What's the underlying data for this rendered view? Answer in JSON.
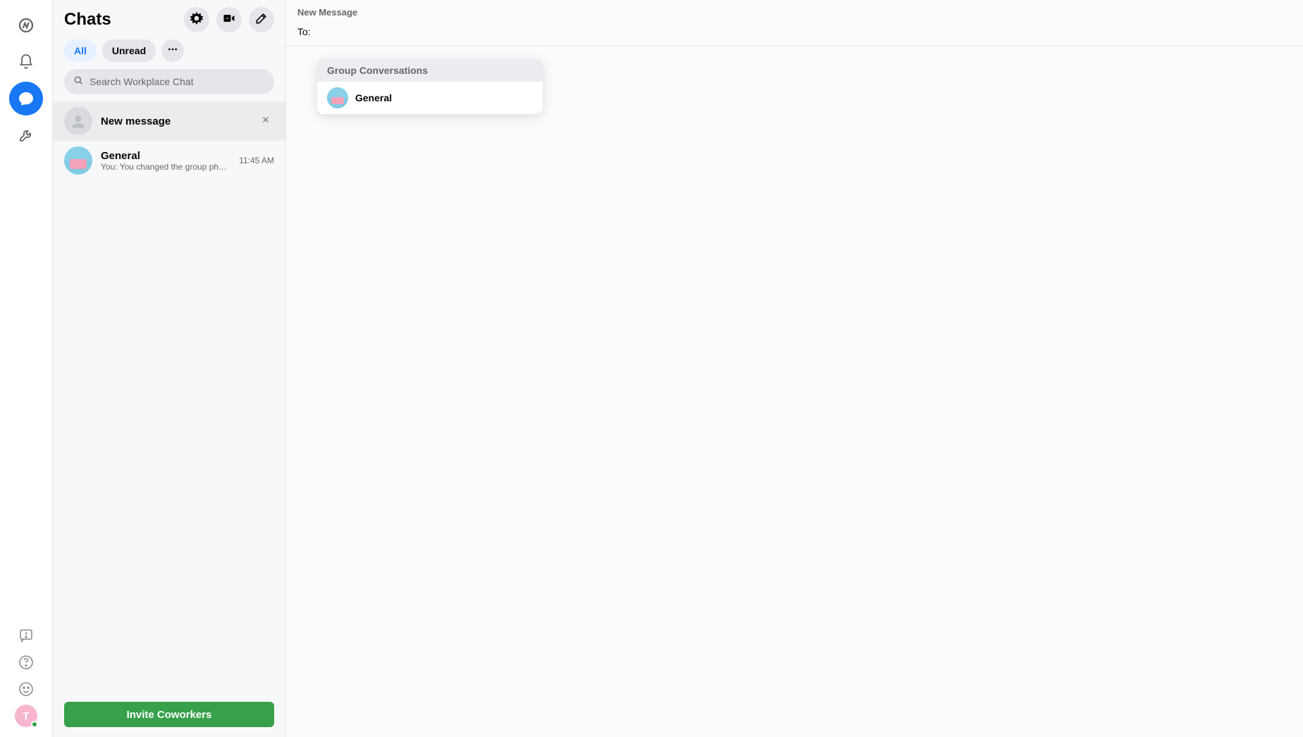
{
  "rail": {
    "avatar_initial": "T"
  },
  "sidebar": {
    "title": "Chats",
    "filters": {
      "all": "All",
      "unread": "Unread"
    },
    "search_placeholder": "Search Workplace Chat",
    "new_message_row": "New message",
    "chat": {
      "name": "General",
      "preview": "You: You changed the group photo.",
      "time": "11:45 AM"
    },
    "invite_label": "Invite Coworkers"
  },
  "compose": {
    "title": "New Message",
    "to_label": "To:",
    "suggestions_header": "Group Conversations",
    "suggestion_name": "General"
  }
}
